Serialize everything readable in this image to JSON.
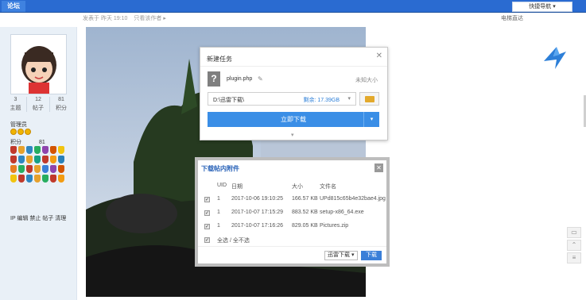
{
  "topbar": {
    "tab": "论坛",
    "quick_nav": "快捷导航 ▾"
  },
  "breadcrumb": [
    "发表于 昨天 19:10",
    "只看该作者 ▸"
  ],
  "subbar_right": "电梯直达",
  "sidebar": {
    "stats": [
      {
        "num": "3",
        "label": "主题"
      },
      {
        "num": "12",
        "label": "帖子"
      },
      {
        "num": "81",
        "label": "积分"
      }
    ],
    "role": "管理员",
    "points_label": "积分",
    "points_value": "81",
    "admin_links": "IP 编辑 禁止 帖子 清理"
  },
  "new_task": {
    "title": "新建任务",
    "filename": "plugin.php",
    "size": "未知大小",
    "path": "D:\\迅雷下载\\",
    "free_space": "剩余: 17.39GB",
    "download_button": "立即下载"
  },
  "attachments": {
    "title": "下载帖内附件",
    "headers": {
      "uid": "UID",
      "date": "日期",
      "size": "大小",
      "name": "文件名"
    },
    "rows": [
      {
        "uid": "1",
        "date": "2017-10-06 19:10:25",
        "size": "166.57 KB",
        "name": "UPd815c65b4e32bae4.jpg"
      },
      {
        "uid": "1",
        "date": "2017-10-07 17:15:29",
        "size": "883.52 KB",
        "name": "setup-x86_64.exe"
      },
      {
        "uid": "1",
        "date": "2017-10-07 17:16:26",
        "size": "829.05 KB",
        "name": "Pictures.zip"
      }
    ],
    "select_all": "全选 / 全不选",
    "downloader": "迅雷下载",
    "download_button": "下载"
  },
  "colors": {
    "topbar": "#2a6bd1",
    "accent": "#3a8ee6",
    "sidebar_bg": "#e9f0f7"
  }
}
